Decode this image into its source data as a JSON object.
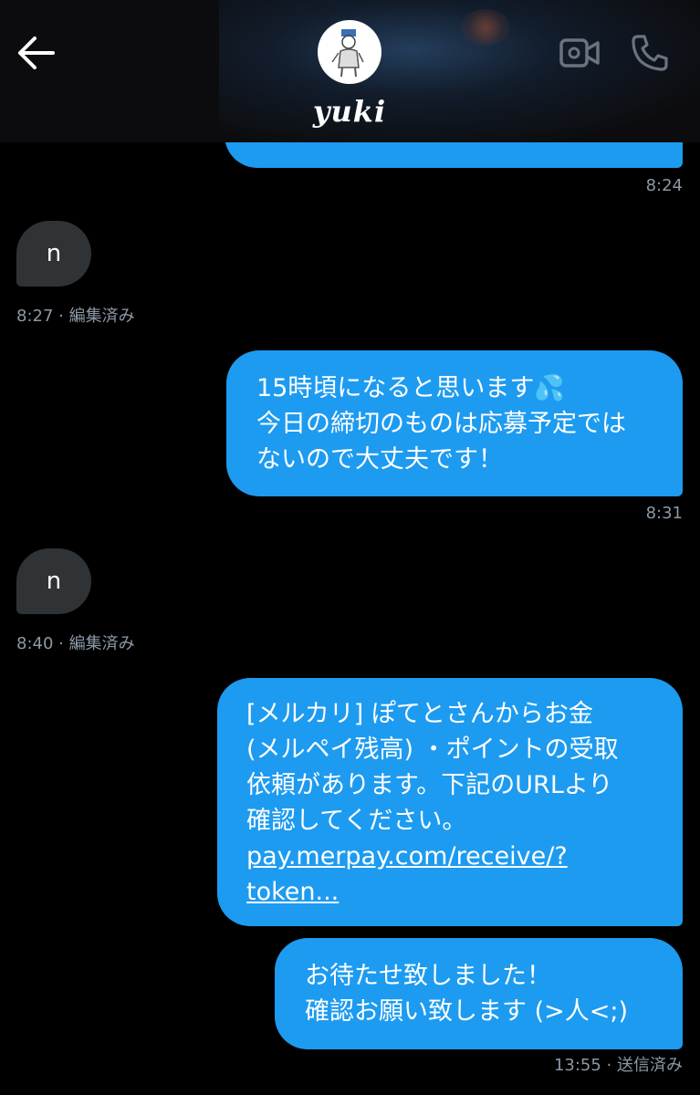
{
  "header": {
    "chat_name": "yuki",
    "back_icon": "arrow-left-icon",
    "video_icon": "video-camera-icon",
    "call_icon": "phone-icon"
  },
  "messages": [
    {
      "direction": "outgoing",
      "lines": [],
      "time": "8:24"
    },
    {
      "direction": "incoming",
      "lines": [
        "n"
      ],
      "time": "8:27 · 編集済み"
    },
    {
      "direction": "outgoing",
      "lines": [
        "15時頃になると思います💦",
        "今日の締切のものは応募予定では",
        "ないので大丈夫です！"
      ],
      "time": "8:31"
    },
    {
      "direction": "incoming",
      "lines": [
        "n"
      ],
      "time": "8:40 · 編集済み"
    },
    {
      "direction": "outgoing",
      "lines": [
        "[メルカリ] ぽてとさんからお金",
        "(メルペイ残高) ・ポイントの受取",
        "依頼があります。下記のURLより",
        "確認してください。"
      ],
      "link_lines": [
        "pay.merpay.com/receive/?",
        "token..."
      ],
      "time": null
    },
    {
      "direction": "outgoing",
      "lines": [
        "お待たせ致しました！",
        "確認お願い致します (>人<;)"
      ],
      "time": "13:55 · 送信済み"
    }
  ],
  "colors": {
    "outgoing_bubble": "#1d9bf0",
    "incoming_bubble": "#2f3336",
    "meta_text": "#8b98a5",
    "background": "#000000"
  }
}
